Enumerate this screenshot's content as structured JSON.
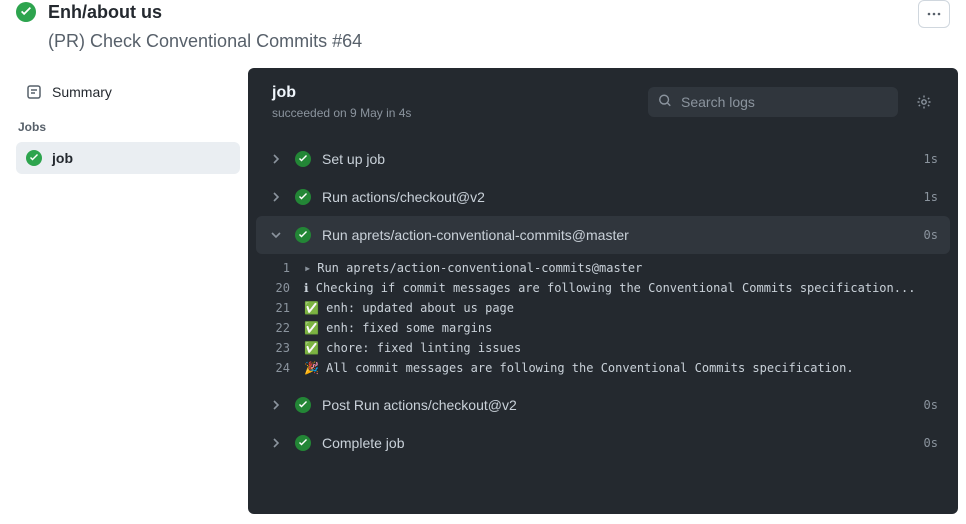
{
  "header": {
    "title": "Enh/about us",
    "subtitle": "(PR) Check Conventional Commits #64"
  },
  "sidebar": {
    "summary_label": "Summary",
    "jobs_heading": "Jobs",
    "jobs": [
      {
        "label": "job",
        "selected": true
      }
    ]
  },
  "content": {
    "title": "job",
    "meta": "succeeded on 9 May in 4s",
    "search_placeholder": "Search logs"
  },
  "steps": [
    {
      "label": "Set up job",
      "duration": "1s",
      "expanded": false
    },
    {
      "label": "Run actions/checkout@v2",
      "duration": "1s",
      "expanded": false
    },
    {
      "label": "Run aprets/action-conventional-commits@master",
      "duration": "0s",
      "expanded": true
    },
    {
      "label": "Post Run actions/checkout@v2",
      "duration": "0s",
      "expanded": false
    },
    {
      "label": "Complete job",
      "duration": "0s",
      "expanded": false
    }
  ],
  "log": [
    {
      "n": "1",
      "t": "Run aprets/action-conventional-commits@master",
      "caret": true
    },
    {
      "n": "20",
      "t": "ℹ Checking if commit messages are following the Conventional Commits specification..."
    },
    {
      "n": "21",
      "t": "✅ enh: updated about us page"
    },
    {
      "n": "22",
      "t": "✅ enh: fixed some margins"
    },
    {
      "n": "23",
      "t": "✅ chore: fixed linting issues"
    },
    {
      "n": "24",
      "t": "🎉 All commit messages are following the Conventional Commits specification."
    }
  ]
}
